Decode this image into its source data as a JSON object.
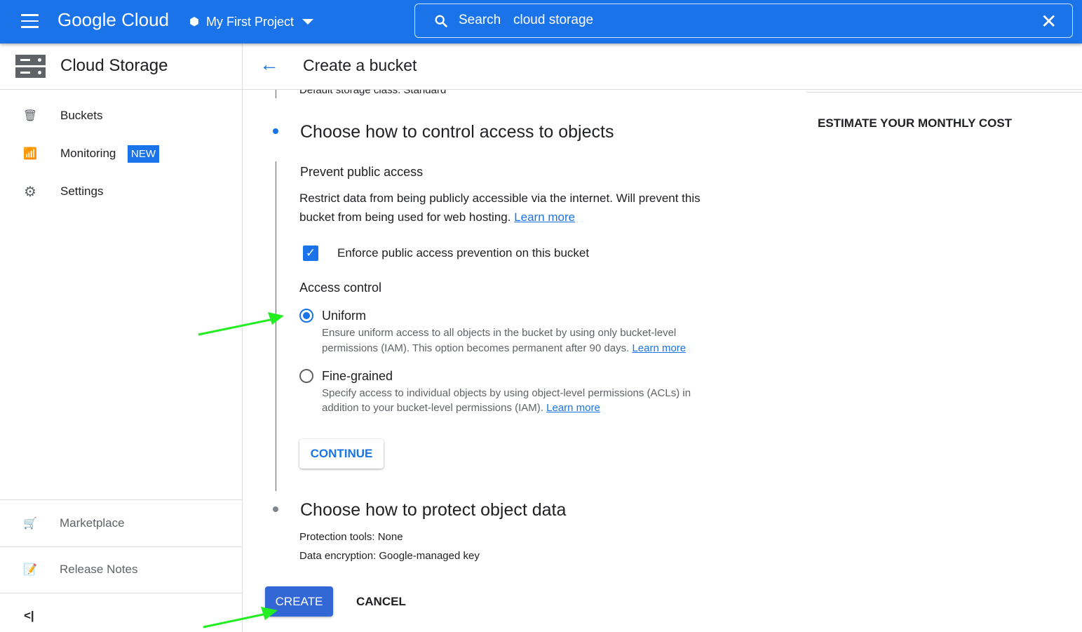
{
  "header": {
    "brand": "Google Cloud",
    "project": "My First Project",
    "search_label": "Search",
    "search_value": "cloud storage"
  },
  "sidebar": {
    "title": "Cloud Storage",
    "items": [
      {
        "label": "Buckets",
        "icon": "bucket-icon"
      },
      {
        "label": "Monitoring",
        "badge": "NEW",
        "icon": "monitoring-icon"
      },
      {
        "label": "Settings",
        "icon": "gear-icon"
      }
    ],
    "bottom": [
      {
        "label": "Marketplace",
        "icon": "cart-icon"
      },
      {
        "label": "Release Notes",
        "icon": "release-notes-icon"
      }
    ],
    "collapse": "<|"
  },
  "page": {
    "title": "Create a bucket",
    "prev_summary": "Default storage class: Standard",
    "section1": {
      "title": "Choose how to control access to objects",
      "prevent_title": "Prevent public access",
      "prevent_desc": "Restrict data from being publicly accessible via the internet. Will prevent this",
      "prevent_desc2": "bucket from being used for web hosting.",
      "learn_more": "Learn more",
      "checkbox_label": "Enforce public access prevention on this bucket",
      "checkbox_checked": true,
      "access_title": "Access control",
      "options": [
        {
          "label": "Uniform",
          "selected": true,
          "desc1": "Ensure uniform access to all objects in the bucket by using only bucket-level",
          "desc2": "permissions (IAM). This option becomes permanent after 90 days.",
          "link": "Learn more"
        },
        {
          "label": "Fine-grained",
          "selected": false,
          "desc1": "Specify access to individual objects by using object-level permissions (ACLs) in",
          "desc2": "addition to your bucket-level permissions (IAM).",
          "link": "Learn more"
        }
      ],
      "continue": "CONTINUE"
    },
    "section2": {
      "title": "Choose how to protect object data",
      "line1": "Protection tools: None",
      "line2": "Data encryption: Google-managed key"
    },
    "create": "CREATE",
    "cancel": "CANCEL"
  },
  "right_panel": {
    "estimate": "ESTIMATE YOUR MONTHLY COST"
  },
  "colors": {
    "primary": "#1a73e8",
    "annotation_arrow": "#22ee22"
  }
}
